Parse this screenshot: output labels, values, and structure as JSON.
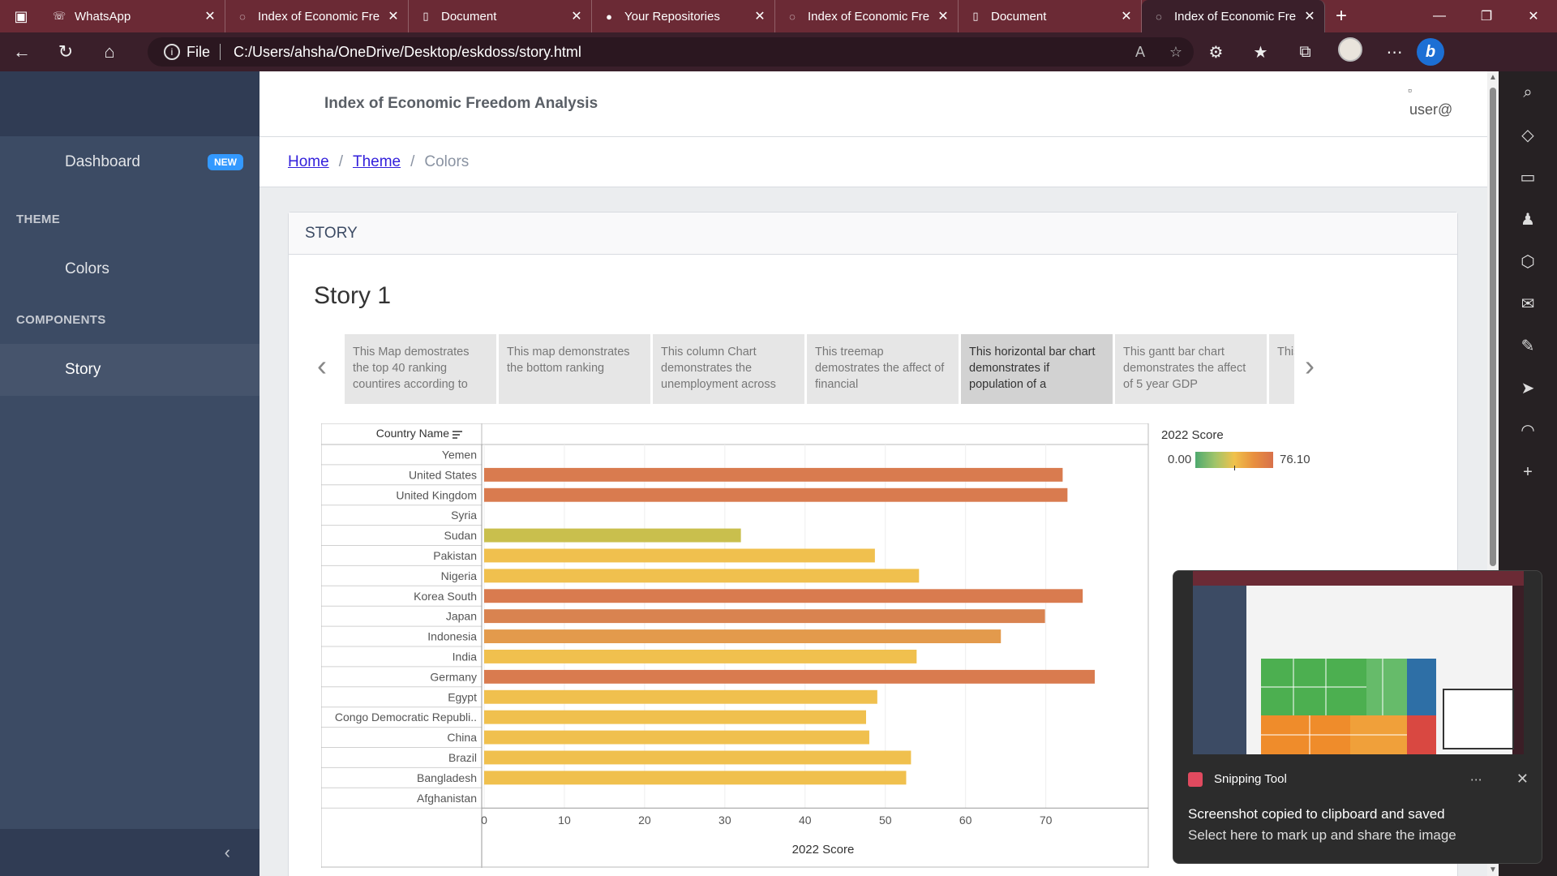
{
  "browser": {
    "tabs": [
      {
        "title": "WhatsApp",
        "icon": "whatsapp-icon",
        "active": false
      },
      {
        "title": "Index of Economic Fre",
        "icon": "page-icon",
        "active": false
      },
      {
        "title": "Document",
        "icon": "document-icon",
        "active": false
      },
      {
        "title": "Your Repositories",
        "icon": "github-icon",
        "active": false
      },
      {
        "title": "Index of Economic Fre",
        "icon": "page-icon",
        "active": false
      },
      {
        "title": "Document",
        "icon": "document-icon",
        "active": false
      },
      {
        "title": "Index of Economic Fre",
        "icon": "page-icon",
        "active": true
      }
    ],
    "address": {
      "scheme": "File",
      "path": "C:/Users/ahsha/OneDrive/Desktop/eskdoss/story.html"
    }
  },
  "sidebar": {
    "dashboard_label": "Dashboard",
    "badge": "NEW",
    "theme_title": "THEME",
    "colors_label": "Colors",
    "components_title": "COMPONENTS",
    "story_label": "Story"
  },
  "header": {
    "title": "Index of Economic Freedom Analysis",
    "user_alt": "user@"
  },
  "breadcrumb": {
    "home": "Home",
    "theme": "Theme",
    "current": "Colors"
  },
  "card": {
    "header": "STORY",
    "story_title": "Story 1"
  },
  "story_points": [
    "This Map demostrates the top 40 ranking countires according to",
    "This map demonstrates the bottom ranking",
    "This column Chart demonstrates the unemployment across",
    "This treemap demostrates the affect of financial",
    "This horizontal bar chart demonstrates if population of a",
    "This gantt bar chart demonstrates the affect of 5 year GDP",
    "This des inf"
  ],
  "legend": {
    "title": "2022 Score",
    "min": "0.00",
    "max": "76.10"
  },
  "chart_data": {
    "type": "bar",
    "orientation": "horizontal",
    "row_header": "Country Name",
    "xlabel": "2022 Score",
    "xlim": [
      0,
      76
    ],
    "x_ticks": [
      0,
      10,
      20,
      30,
      40,
      50,
      60,
      70
    ],
    "categories": [
      "Yemen",
      "United States",
      "United Kingdom",
      "Syria",
      "Sudan",
      "Pakistan",
      "Nigeria",
      "Korea South",
      "Japan",
      "Indonesia",
      "India",
      "Germany",
      "Egypt",
      "Congo Democratic Republi..",
      "China",
      "Brazil",
      "Bangladesh",
      "Afghanistan"
    ],
    "values": [
      0,
      72.1,
      72.7,
      0,
      32.0,
      48.7,
      54.2,
      74.6,
      69.9,
      64.4,
      53.9,
      76.1,
      49.0,
      47.6,
      48.0,
      53.2,
      52.6,
      0
    ]
  },
  "toast": {
    "app": "Snipping Tool",
    "line1": "Screenshot copied to clipboard and saved",
    "line2": "Select here to mark up and share the image"
  }
}
